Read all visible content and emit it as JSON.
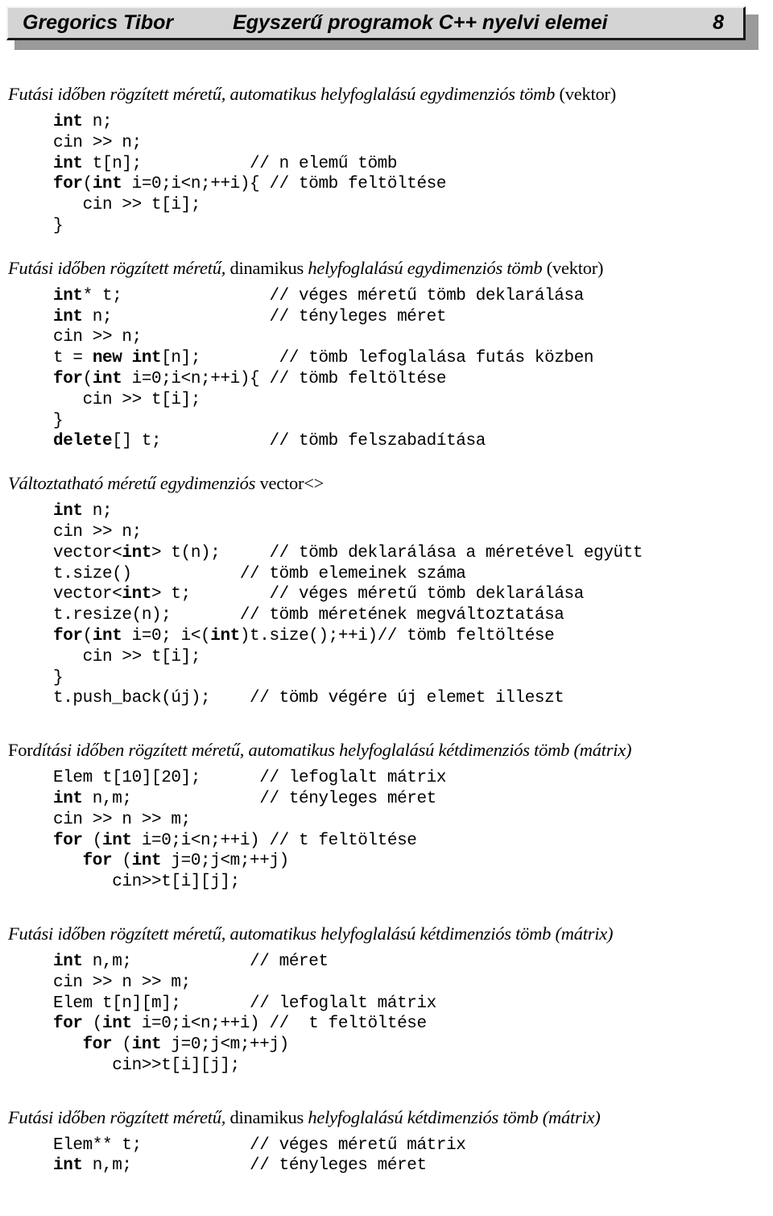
{
  "header": {
    "author": "Gregorics Tibor",
    "title": "Egyszerű programok C++ nyelvi elemei",
    "page": "8"
  },
  "sections": [
    {
      "heading_parts": [
        {
          "text": "Futási időben rögzített méretű, automatikus helyfoglalású egydimenziós tömb ",
          "style": "italic"
        },
        {
          "text": "(vektor)",
          "style": "upright"
        }
      ],
      "heading_plain": "Futási időben rögzített méretű, automatikus helyfoglalású egydimenziós tömb (vektor)",
      "lines": [
        [
          {
            "t": "int",
            "b": true
          },
          {
            "t": " n;",
            "b": false
          }
        ],
        [
          {
            "t": "cin >> n;",
            "b": false
          }
        ],
        [
          {
            "t": "int",
            "b": true
          },
          {
            "t": " t[n];           // n elemű tömb",
            "b": false
          }
        ],
        [
          {
            "t": "for",
            "b": true
          },
          {
            "t": "(",
            "b": false
          },
          {
            "t": "int",
            "b": true
          },
          {
            "t": " i=0;i<n;++i){ // tömb feltöltése",
            "b": false
          }
        ],
        [
          {
            "t": "   cin >> t[i];",
            "b": false
          }
        ],
        [
          {
            "t": "}",
            "b": false
          }
        ]
      ]
    },
    {
      "heading_parts": [
        {
          "text": "Futási időben rögzített méretű, ",
          "style": "italic"
        },
        {
          "text": "dinamikus ",
          "style": "upright"
        },
        {
          "text": "helyfoglalású egydimenziós tömb ",
          "style": "italic"
        },
        {
          "text": "(vektor)",
          "style": "upright"
        }
      ],
      "heading_plain": "Futási időben rögzített méretű, dinamikus helyfoglalású egydimenziós tömb (vektor)",
      "lines": [
        [
          {
            "t": "int",
            "b": true
          },
          {
            "t": "* t;               // véges méretű tömb deklarálása",
            "b": false
          }
        ],
        [
          {
            "t": "int",
            "b": true
          },
          {
            "t": " n;                // tényleges méret",
            "b": false
          }
        ],
        [
          {
            "t": "cin >> n;",
            "b": false
          }
        ],
        [
          {
            "t": "t = ",
            "b": false
          },
          {
            "t": "new int",
            "b": true
          },
          {
            "t": "[n];        // tömb lefoglalása futás közben",
            "b": false
          }
        ],
        [
          {
            "t": "for",
            "b": true
          },
          {
            "t": "(",
            "b": false
          },
          {
            "t": "int",
            "b": true
          },
          {
            "t": " i=0;i<n;++i){ // tömb feltöltése",
            "b": false
          }
        ],
        [
          {
            "t": "   cin >> t[i];",
            "b": false
          }
        ],
        [
          {
            "t": "}",
            "b": false
          }
        ],
        [
          {
            "t": "delete",
            "b": true
          },
          {
            "t": "[] t;           // tömb felszabadítása",
            "b": false
          }
        ]
      ]
    },
    {
      "heading_parts": [
        {
          "text": "Változtatható méretű egydimenziós ",
          "style": "italic"
        },
        {
          "text": "vector<>",
          "style": "upright"
        }
      ],
      "heading_plain": "Változtatható méretű egydimenziós vector<>",
      "lines": [
        [
          {
            "t": "int",
            "b": true
          },
          {
            "t": " n;",
            "b": false
          }
        ],
        [
          {
            "t": "cin >> n;",
            "b": false
          }
        ],
        [
          {
            "t": "vector<",
            "b": false
          },
          {
            "t": "int",
            "b": true
          },
          {
            "t": "> t(n);     // tömb deklarálása a méretével együtt",
            "b": false
          }
        ],
        [
          {
            "t": "t.size()           // tömb elemeinek száma",
            "b": false
          }
        ],
        [
          {
            "t": "vector<",
            "b": false
          },
          {
            "t": "int",
            "b": true
          },
          {
            "t": "> t;        // véges méretű tömb deklarálása",
            "b": false
          }
        ],
        [
          {
            "t": "t.resize(n);       // tömb méretének megváltoztatása",
            "b": false
          }
        ],
        [
          {
            "t": "for",
            "b": true
          },
          {
            "t": "(",
            "b": false
          },
          {
            "t": "int",
            "b": true
          },
          {
            "t": " i=0; i<(",
            "b": false
          },
          {
            "t": "int",
            "b": true
          },
          {
            "t": ")t.size();++i)// tömb feltöltése",
            "b": false
          }
        ],
        [
          {
            "t": "   cin >> t[i];",
            "b": false
          }
        ],
        [
          {
            "t": "}",
            "b": false
          }
        ],
        [
          {
            "t": "t.push_back(új);    // tömb végére új elemet illeszt",
            "b": false
          }
        ]
      ]
    },
    {
      "heading_parts": [
        {
          "text": "For",
          "style": "upright"
        },
        {
          "text": "dítási időben rögzített méretű, automatikus helyfoglalású kétdimenziós tömb (mátrix)",
          "style": "italic"
        }
      ],
      "heading_plain": "Fordítási időben rögzített méretű, automatikus helyfoglalású kétdimenziós tömb (mátrix)",
      "lines": [
        [
          {
            "t": "Elem t[10][20];      // lefoglalt mátrix",
            "b": false
          }
        ],
        [
          {
            "t": "int",
            "b": true
          },
          {
            "t": " n,m;             // tényleges méret",
            "b": false
          }
        ],
        [
          {
            "t": "cin >> n >> m;",
            "b": false
          }
        ],
        [
          {
            "t": "for",
            "b": true
          },
          {
            "t": " (",
            "b": false
          },
          {
            "t": "int",
            "b": true
          },
          {
            "t": " i=0;i<n;++i) // t feltöltése",
            "b": false
          }
        ],
        [
          {
            "t": "   ",
            "b": false
          },
          {
            "t": "for",
            "b": true
          },
          {
            "t": " (",
            "b": false
          },
          {
            "t": "int",
            "b": true
          },
          {
            "t": " j=0;j<m;++j)",
            "b": false
          }
        ],
        [
          {
            "t": "      cin>>t[i][j];",
            "b": false
          }
        ]
      ]
    },
    {
      "heading_parts": [
        {
          "text": "Futási időben rögzített méretű, automatikus helyfoglalású kétdimenziós tömb (mátrix)",
          "style": "italic"
        }
      ],
      "heading_plain": "Futási időben rögzített méretű, automatikus helyfoglalású kétdimenziós tömb (mátrix)",
      "lines": [
        [
          {
            "t": "int",
            "b": true
          },
          {
            "t": " n,m;            // méret",
            "b": false
          }
        ],
        [
          {
            "t": "cin >> n >> m;",
            "b": false
          }
        ],
        [
          {
            "t": "Elem t[n][m];       // lefoglalt mátrix",
            "b": false
          }
        ],
        [
          {
            "t": "for",
            "b": true
          },
          {
            "t": " (",
            "b": false
          },
          {
            "t": "int",
            "b": true
          },
          {
            "t": " i=0;i<n;++i) //  t feltöltése",
            "b": false
          }
        ],
        [
          {
            "t": "   ",
            "b": false
          },
          {
            "t": "for",
            "b": true
          },
          {
            "t": " (",
            "b": false
          },
          {
            "t": "int",
            "b": true
          },
          {
            "t": " j=0;j<m;++j)",
            "b": false
          }
        ],
        [
          {
            "t": "      cin>>t[i][j];",
            "b": false
          }
        ]
      ]
    },
    {
      "heading_parts": [
        {
          "text": "Futási időben rögzített méretű, ",
          "style": "italic"
        },
        {
          "text": "dinamikus ",
          "style": "upright"
        },
        {
          "text": "helyfoglalású kétdimenziós tömb (mátrix)",
          "style": "italic"
        }
      ],
      "heading_plain": "Futási időben rögzített méretű, dinamikus helyfoglalású kétdimenziós tömb (mátrix)",
      "lines": [
        [
          {
            "t": "Elem** t;           // véges méretű mátrix",
            "b": false
          }
        ],
        [
          {
            "t": "int",
            "b": true
          },
          {
            "t": " n,m;            // tényleges méret",
            "b": false
          }
        ]
      ]
    }
  ],
  "spacing": [
    {
      "before": 0,
      "after": 26
    },
    {
      "before": 0,
      "after": 26
    },
    {
      "before": 0,
      "after": 38
    },
    {
      "before": 0,
      "after": 38
    },
    {
      "before": 0,
      "after": 38
    },
    {
      "before": 0,
      "after": 0
    }
  ]
}
